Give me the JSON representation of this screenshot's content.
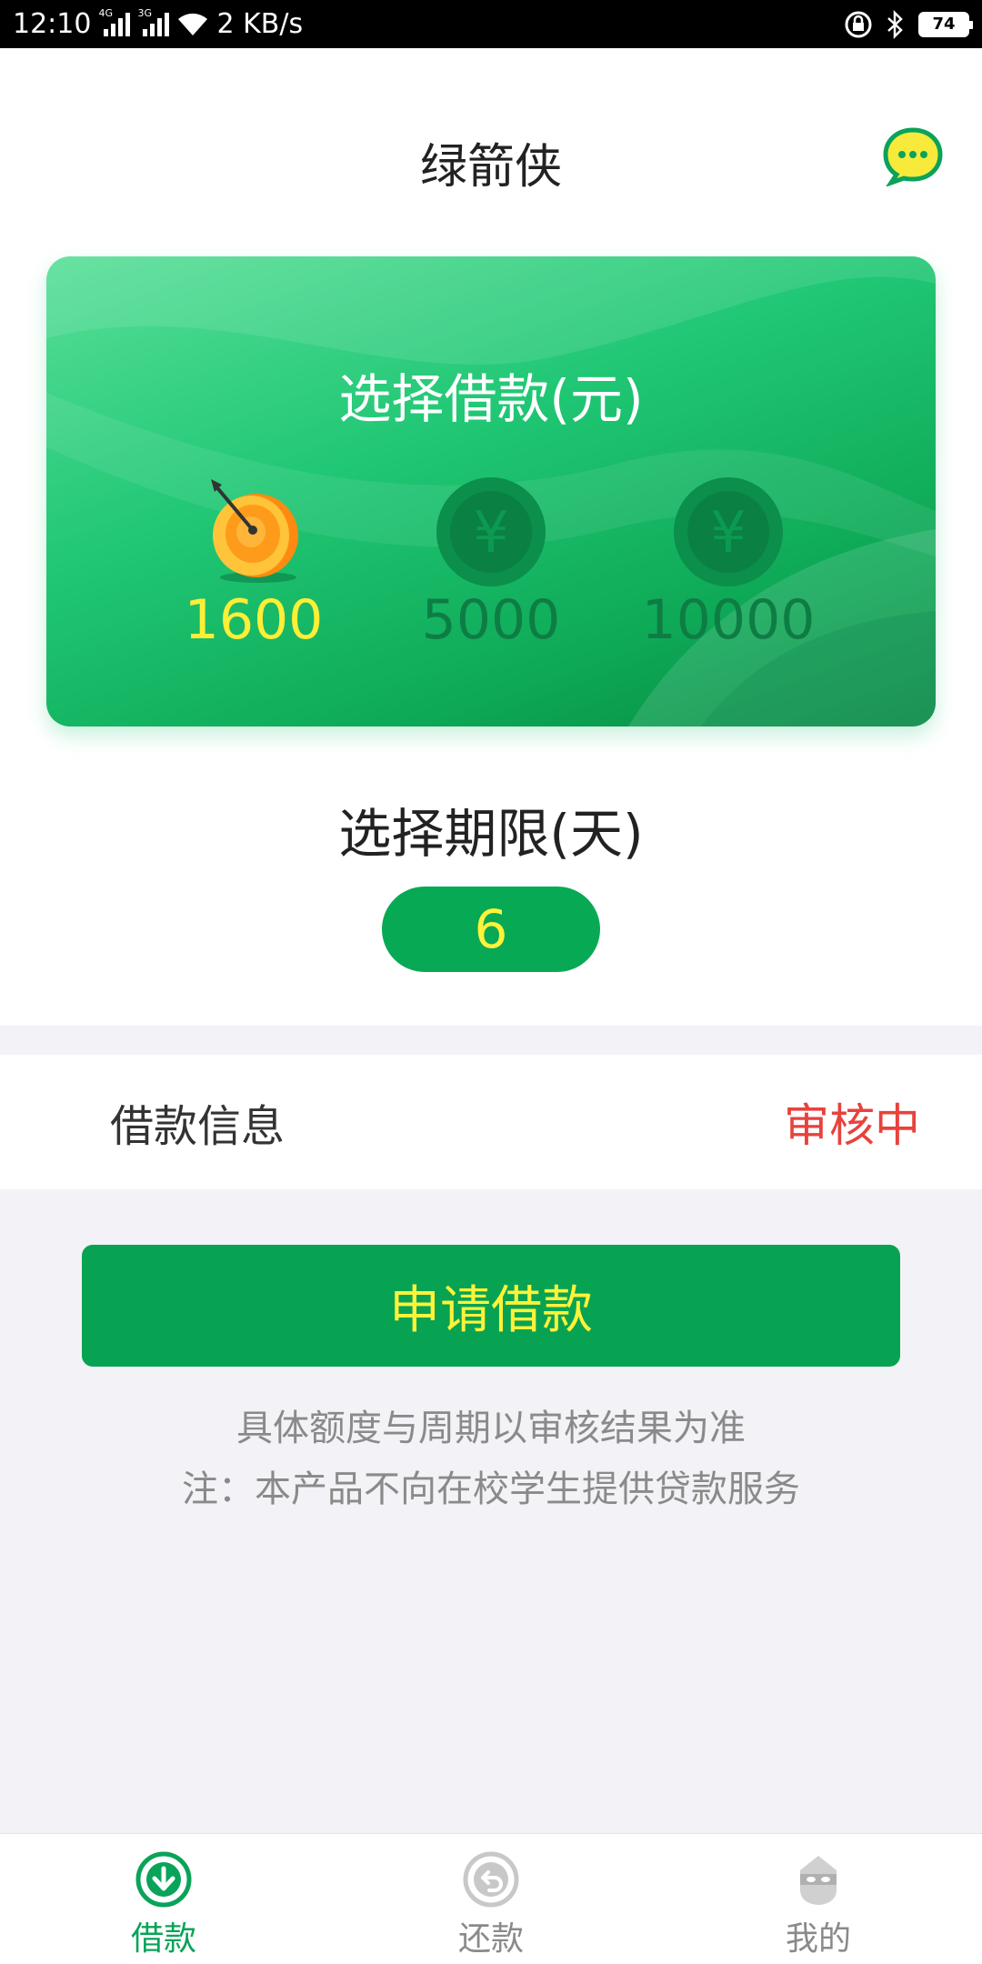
{
  "status_bar": {
    "time": "12:10",
    "net_4g": "4G",
    "net_3g": "3G",
    "speed": "2 KB/s",
    "battery": "74"
  },
  "header": {
    "title": "绿箭侠",
    "chat_icon": "chat-bubble-icon"
  },
  "loan_card": {
    "title": "选择借款(元)",
    "amounts": [
      {
        "value": "1600",
        "selected": true,
        "icon": "target-dart-icon"
      },
      {
        "value": "5000",
        "selected": false,
        "icon": "yuan-coin-icon"
      },
      {
        "value": "10000",
        "selected": false,
        "icon": "yuan-coin-icon"
      }
    ]
  },
  "term": {
    "label": "选择期限(天)",
    "value": "6"
  },
  "loan_info": {
    "label": "借款信息",
    "status": "审核中"
  },
  "apply_button": {
    "label": "申请借款"
  },
  "notes": [
    "具体额度与周期以审核结果为准",
    "注：本产品不向在校学生提供贷款服务"
  ],
  "colors": {
    "brand_green": "#07a352",
    "accent_yellow": "#fff23a",
    "status_red": "#e8423c"
  },
  "tabbar": [
    {
      "label": "借款",
      "icon": "download-circle-icon",
      "active": true
    },
    {
      "label": "还款",
      "icon": "return-circle-icon",
      "active": false
    },
    {
      "label": "我的",
      "icon": "profile-mask-icon",
      "active": false
    }
  ]
}
